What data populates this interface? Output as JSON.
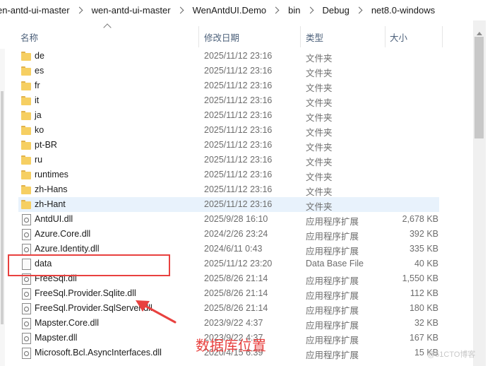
{
  "breadcrumb": [
    "en-antd-ui-master",
    "wen-antd-ui-master",
    "WenAntdUI.Demo",
    "bin",
    "Debug",
    "net8.0-windows"
  ],
  "columns": {
    "name": "名称",
    "date": "修改日期",
    "type": "类型",
    "size": "大小"
  },
  "rows": [
    {
      "name": "de",
      "date": "2025/11/12 23:16",
      "type": "文件夹",
      "size": "",
      "icon": "folder-icon"
    },
    {
      "name": "es",
      "date": "2025/11/12 23:16",
      "type": "文件夹",
      "size": "",
      "icon": "folder-icon"
    },
    {
      "name": "fr",
      "date": "2025/11/12 23:16",
      "type": "文件夹",
      "size": "",
      "icon": "folder-icon"
    },
    {
      "name": "it",
      "date": "2025/11/12 23:16",
      "type": "文件夹",
      "size": "",
      "icon": "folder-icon"
    },
    {
      "name": "ja",
      "date": "2025/11/12 23:16",
      "type": "文件夹",
      "size": "",
      "icon": "folder-icon"
    },
    {
      "name": "ko",
      "date": "2025/11/12 23:16",
      "type": "文件夹",
      "size": "",
      "icon": "folder-icon"
    },
    {
      "name": "pt-BR",
      "date": "2025/11/12 23:16",
      "type": "文件夹",
      "size": "",
      "icon": "folder-icon"
    },
    {
      "name": "ru",
      "date": "2025/11/12 23:16",
      "type": "文件夹",
      "size": "",
      "icon": "folder-icon"
    },
    {
      "name": "runtimes",
      "date": "2025/11/12 23:16",
      "type": "文件夹",
      "size": "",
      "icon": "folder-icon"
    },
    {
      "name": "zh-Hans",
      "date": "2025/11/12 23:16",
      "type": "文件夹",
      "size": "",
      "icon": "folder-icon"
    },
    {
      "name": "zh-Hant",
      "date": "2025/11/12 23:16",
      "type": "文件夹",
      "size": "",
      "icon": "folder-icon",
      "hover": true
    },
    {
      "name": "AntdUI.dll",
      "date": "2025/9/28 16:10",
      "type": "应用程序扩展",
      "size": "2,678 KB",
      "icon": "dll-file-icon"
    },
    {
      "name": "Azure.Core.dll",
      "date": "2024/2/26 23:24",
      "type": "应用程序扩展",
      "size": "392 KB",
      "icon": "dll-file-icon"
    },
    {
      "name": "Azure.Identity.dll",
      "date": "2024/6/11 0:43",
      "type": "应用程序扩展",
      "size": "335 KB",
      "icon": "dll-file-icon"
    },
    {
      "name": "data",
      "date": "2025/11/12 23:20",
      "type": "Data Base File",
      "size": "40 KB",
      "icon": "file-icon"
    },
    {
      "name": "FreeSql.dll",
      "date": "2025/8/26 21:14",
      "type": "应用程序扩展",
      "size": "1,550 KB",
      "icon": "dll-file-icon"
    },
    {
      "name": "FreeSql.Provider.Sqlite.dll",
      "date": "2025/8/26 21:14",
      "type": "应用程序扩展",
      "size": "112 KB",
      "icon": "dll-file-icon"
    },
    {
      "name": "FreeSql.Provider.SqlServer.dll",
      "date": "2025/8/26 21:14",
      "type": "应用程序扩展",
      "size": "180 KB",
      "icon": "dll-file-icon"
    },
    {
      "name": "Mapster.Core.dll",
      "date": "2023/9/22 4:37",
      "type": "应用程序扩展",
      "size": "32 KB",
      "icon": "dll-file-icon"
    },
    {
      "name": "Mapster.dll",
      "date": "2023/9/22 4:37",
      "type": "应用程序扩展",
      "size": "167 KB",
      "icon": "dll-file-icon"
    },
    {
      "name": "Microsoft.Bcl.AsyncInterfaces.dll",
      "date": "2020/4/15 6:39",
      "type": "应用程序扩展",
      "size": "15 KB",
      "icon": "dll-file-icon"
    }
  ],
  "annotation": {
    "caption": "数据库位置",
    "color": "#e8413f"
  },
  "watermark": "@51CTO博客"
}
